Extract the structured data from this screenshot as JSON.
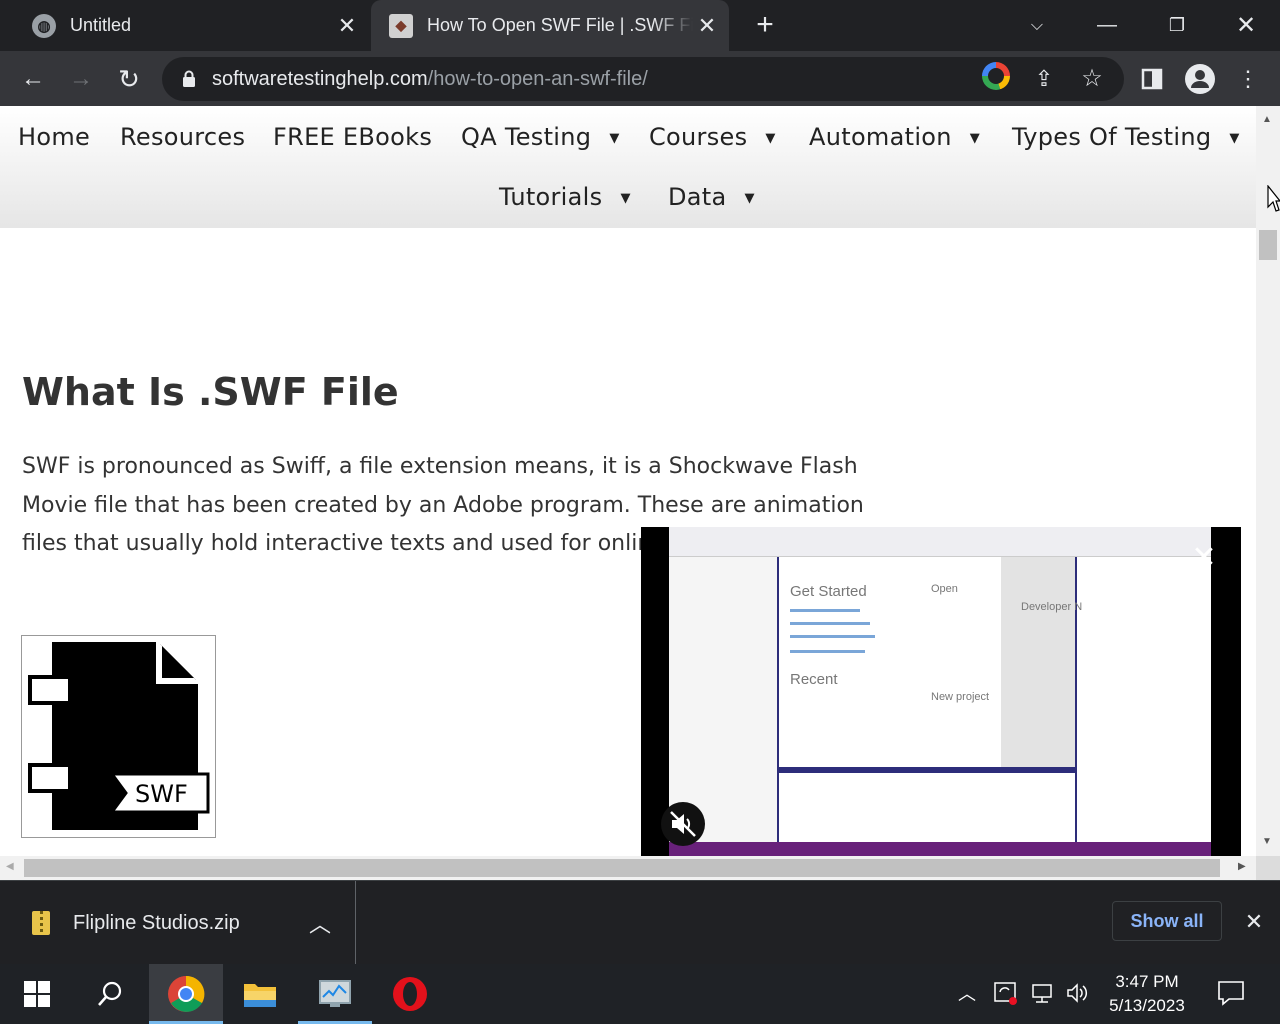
{
  "tabs": [
    {
      "title": "Untitled",
      "favicon": "globe-icon",
      "active": false
    },
    {
      "title": "How To Open SWF File | .SWF File",
      "favicon": "site-favicon",
      "active": true
    }
  ],
  "omnibox": {
    "domain": "softwaretestinghelp.com",
    "path": "/how-to-open-an-swf-file/"
  },
  "nav": {
    "home": "Home",
    "resources": "Resources",
    "ebooks": "FREE EBooks",
    "qa_testing": "QA Testing",
    "courses": "Courses",
    "automation": "Automation",
    "types_of_testing": "Types Of Testing",
    "tutorials": "Tutorials",
    "data": "Data",
    "caret": "▼"
  },
  "article": {
    "heading": "What Is .SWF File",
    "paragraph": "SWF is pronounced as Swiff, a file extension means, it is a Shockwave Flash Movie file that has been created by an Adobe program. These are animation files that usually hold interactive texts and used for online games.",
    "image_label": "SWF"
  },
  "video": {
    "get_started": "Get Started",
    "open": "Open",
    "recent": "Recent",
    "new_project": "New project",
    "developer_news": "Developer N"
  },
  "downloads": {
    "filename": "Flipline Studios.zip",
    "show_all": "Show all"
  },
  "taskbar": {
    "time": "3:47 PM",
    "date": "5/13/2023"
  },
  "colors": {
    "tabstrip": "#202124",
    "toolbar": "#35363a",
    "link": "#8ab4f8",
    "vs_accent": "#68217a"
  }
}
